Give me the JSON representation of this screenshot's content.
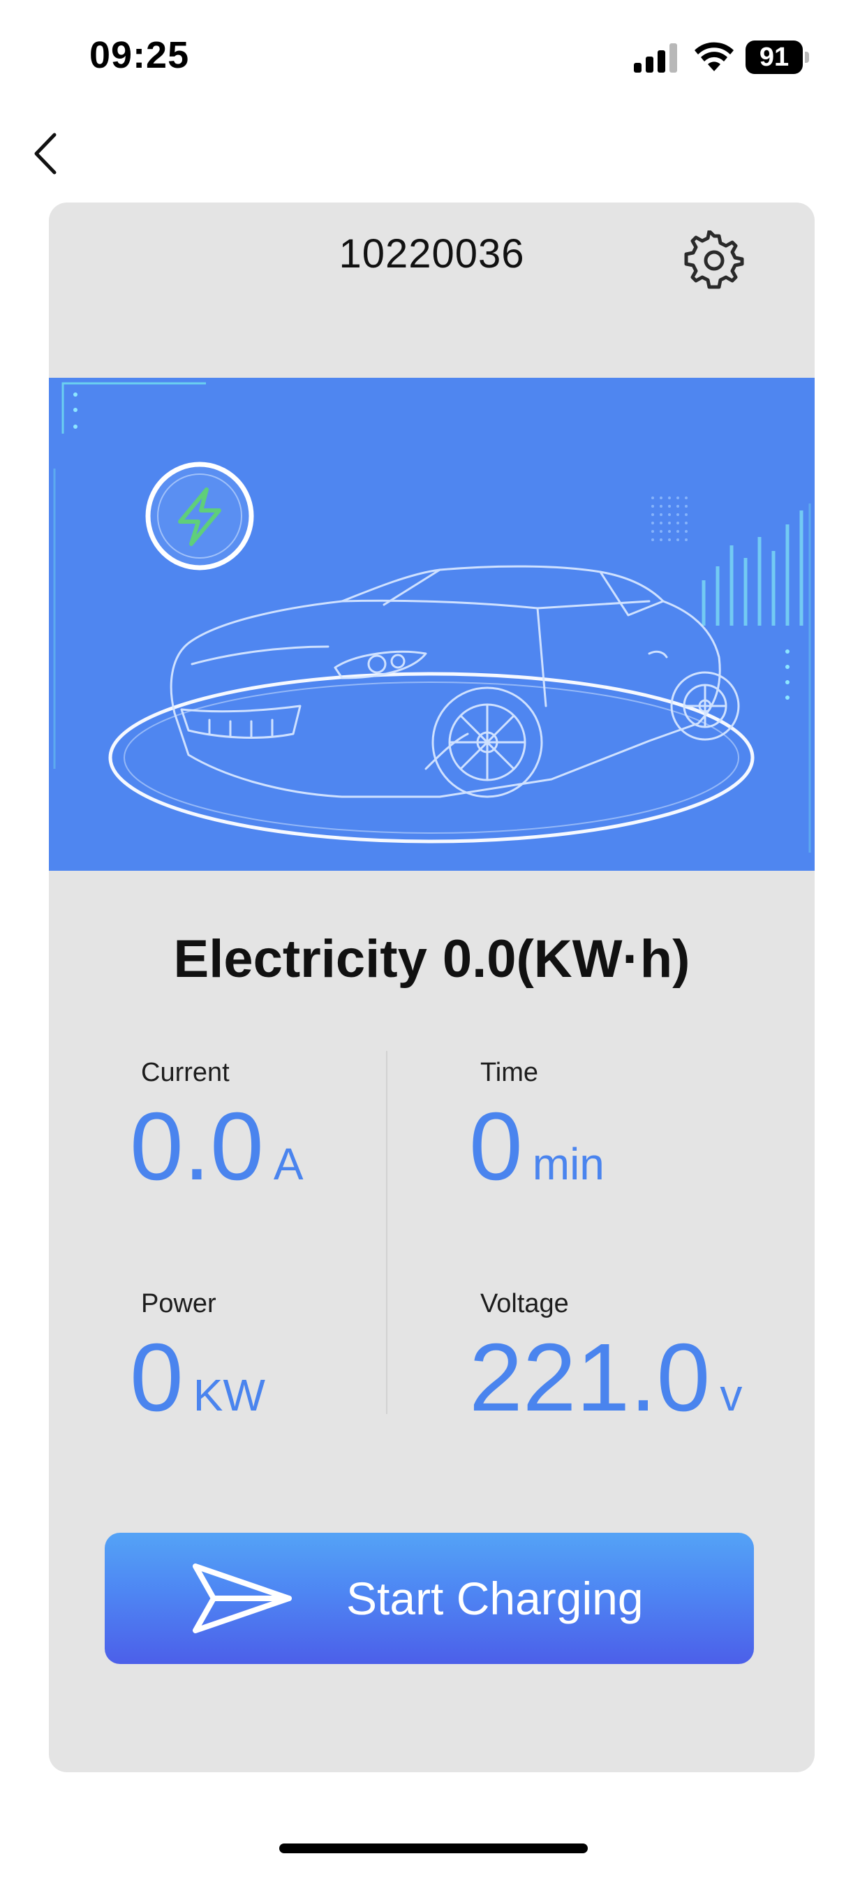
{
  "status_bar": {
    "time": "09:25",
    "battery_level": "91",
    "icons": [
      "signal-icon",
      "wifi-icon",
      "battery-icon"
    ]
  },
  "nav": {
    "back_icon": "chevron-left-icon"
  },
  "device": {
    "id": "10220036",
    "settings_icon": "gear-icon"
  },
  "hero": {
    "badge_icon": "lightning-bolt-icon",
    "illustration": "sports-car-illustration"
  },
  "electricity": {
    "label": "Electricity",
    "value": "0.0(KW·h)"
  },
  "metrics": {
    "current": {
      "label": "Current",
      "value": "0.0",
      "unit": "A"
    },
    "time": {
      "label": "Time",
      "value": "0",
      "unit": "min"
    },
    "power": {
      "label": "Power",
      "value": "0",
      "unit": "KW"
    },
    "voltage": {
      "label": "Voltage",
      "value": "221.0",
      "unit": "v"
    }
  },
  "action": {
    "label": "Start Charging",
    "icon": "send-icon"
  },
  "colors": {
    "accent": "#4a84ee",
    "hero_background": "#4f86f0",
    "card_background": "#e4e4e4",
    "bolt": "#5fcf7a",
    "button_gradient_top": "#54a3f6",
    "button_gradient_bottom": "#4c5fe9"
  }
}
